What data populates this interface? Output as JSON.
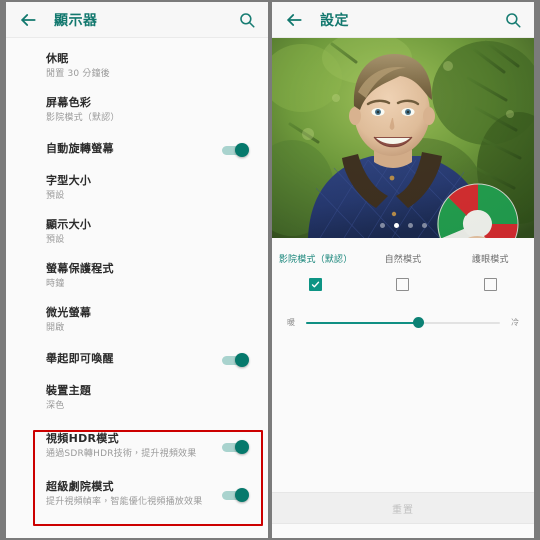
{
  "left_panel": {
    "appbar": {
      "back_icon": "arrow-left-icon",
      "title": "顯示器",
      "search_icon": "search-icon"
    },
    "items": [
      {
        "title": "休眠",
        "subtitle": "閒置 30 分鐘後",
        "toggle": null
      },
      {
        "title": "屏幕色彩",
        "subtitle": "影院模式（默認）",
        "toggle": null
      },
      {
        "title": "自動旋轉螢幕",
        "subtitle": "",
        "toggle": "on"
      },
      {
        "title": "字型大小",
        "subtitle": "預設",
        "toggle": null
      },
      {
        "title": "顯示大小",
        "subtitle": "預設",
        "toggle": null
      },
      {
        "title": "螢幕保護程式",
        "subtitle": "時鐘",
        "toggle": null
      },
      {
        "title": "微光螢幕",
        "subtitle": "開啟",
        "toggle": null
      },
      {
        "title": "舉起即可喚醒",
        "subtitle": "",
        "toggle": "on"
      },
      {
        "title": "裝置主題",
        "subtitle": "深色",
        "toggle": null
      },
      {
        "title": "視頻HDR模式",
        "subtitle": "通過SDR轉HDR技術，提升視頻效果",
        "toggle": "on"
      },
      {
        "title": "超級劇院模式",
        "subtitle": "提升視頻幀率，智能優化視頻播放效果",
        "toggle": "on"
      }
    ],
    "highlight": {
      "color": "#cc0000"
    }
  },
  "right_panel": {
    "appbar": {
      "back_icon": "arrow-left-icon",
      "title": "設定",
      "search_icon": "search-icon"
    },
    "preview": {
      "name": "sample-photo-boy-with-ball",
      "page_dots": {
        "count": 4,
        "active_index": 1
      }
    },
    "modes": [
      {
        "label": "影院模式（默認）",
        "checked": true
      },
      {
        "label": "自然模式",
        "checked": false
      },
      {
        "label": "護眼模式",
        "checked": false
      }
    ],
    "temperature_slider": {
      "left_label": "暖",
      "right_label": "冷",
      "value_percent": 58
    },
    "reset_button": {
      "label": "重置",
      "enabled": false
    }
  },
  "colors": {
    "accent": "#0d9484",
    "appbar_title": "#12786e",
    "highlight": "#cc0000",
    "backdrop": "#7b7b7b"
  }
}
